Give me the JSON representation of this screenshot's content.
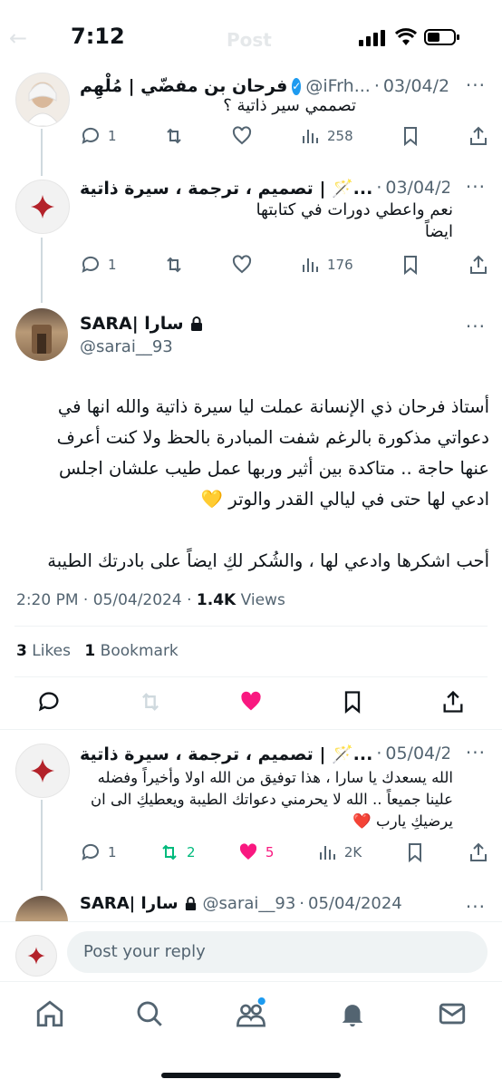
{
  "status": {
    "time": "7:12"
  },
  "header": {
    "title": "Post"
  },
  "colors": {
    "accent": "#1d9bf0",
    "like": "#f91880",
    "retweet": "#00ba7c",
    "text": "#0f1419",
    "muted": "#536471"
  },
  "tweet1": {
    "display_name": "فرحان بن مفضّي | مُلْهِم",
    "handle": "@iFrh...",
    "date": "03/04/2024",
    "text": "تصممي سير ذاتية ؟",
    "replies": "1",
    "views": "258"
  },
  "tweet2": {
    "display_name": "تصميم ، ترجمة ، سيرة ذاتية | 🪄...",
    "date": "03/04/2024",
    "text": "نعم واعطي دورات في كتابتها ايضاً",
    "replies": "1",
    "views": "176"
  },
  "main": {
    "display_name": "SARA| سارا",
    "handle": "@sarai__93",
    "lines": [
      "أستاذ فرحان ذي الإنسانة عملت ليا سيرة ذاتية والله انها في",
      "دعواتي مذكورة بالرغم شفت المبادرة بالحظ ولا كنت أعرف",
      "عنها حاجة .. متاكدة بين أثير وربها عمل طيب علشان اجلس",
      "ادعي لها حتى في ليالي القدر والوتر 💛"
    ],
    "line2": "أحب اشكرها وادعي لها ، والشُكر لكِ ايضاً على بادرتك الطيبة",
    "timestamp": "2:20 PM · 05/04/2024 ·",
    "views_count": "1.4K",
    "views_label": "Views",
    "likes_count": "3",
    "likes_label": "Likes",
    "bookmarks_count": "1",
    "bookmarks_label": "Bookmark"
  },
  "reply": {
    "display_name": "تصميم ، ترجمة ، سيرة ذاتية | 🪄...",
    "date": "05/04/2024",
    "lines": [
      "الله يسعدك يا سارا ، هذا توفيق من الله اولا وأخيراً وفضله",
      "علينا جميعاً .. الله لا يحرمني دعواتك الطيبة ويعطيكِ الى ان",
      "يرضيكِ يارب ❤️"
    ],
    "replies": "1",
    "retweets": "2",
    "likes": "5",
    "views": "2K"
  },
  "partial": {
    "display_name": "SARA| سارا",
    "handle": "@sarai__93",
    "date": "05/04/2024"
  },
  "composer": {
    "placeholder": "Post your reply"
  }
}
